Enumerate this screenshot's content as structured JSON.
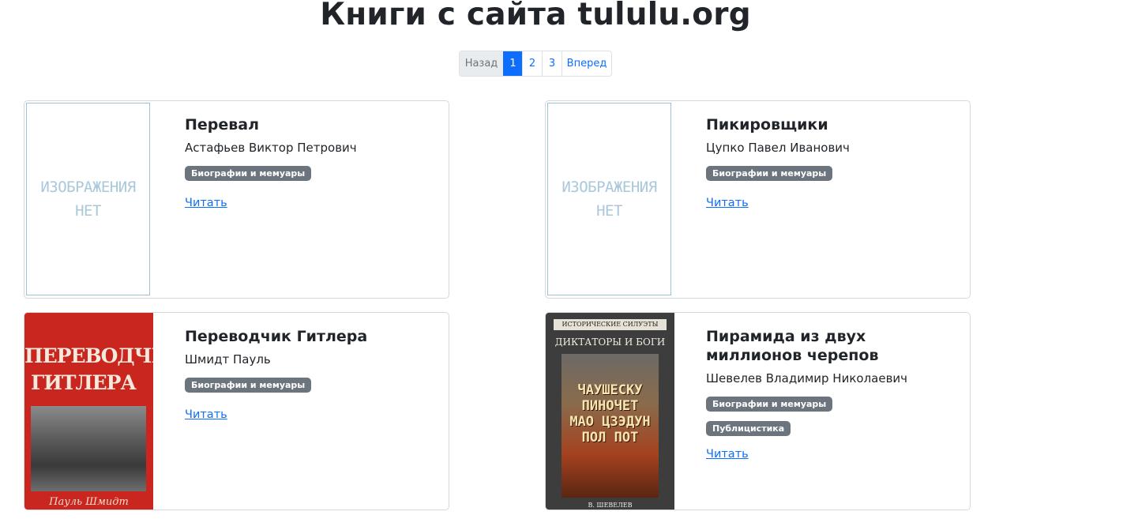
{
  "page": {
    "title": "Книги с сайта tululu.org"
  },
  "pagination": {
    "prev": "Назад",
    "pages": [
      "1",
      "2",
      "3"
    ],
    "current": "1",
    "next": "Вперед"
  },
  "no_image_text": [
    "ИЗОБРАЖЕНИЯ",
    "НЕТ"
  ],
  "books": [
    {
      "title": "Перевал",
      "author": "Астафьев Виктор Петрович",
      "genres": [
        "Биографии и мемуары"
      ],
      "read": "Читать",
      "cover": "no-image"
    },
    {
      "title": "Пикировщики",
      "author": "Цупко Павел Иванович",
      "genres": [
        "Биографии и мемуары"
      ],
      "read": "Читать",
      "cover": "no-image"
    },
    {
      "title": "Переводчик Гитлера",
      "author": "Шмидт Пауль",
      "genres": [
        "Биографии и мемуары"
      ],
      "read": "Читать",
      "cover": "red-cover",
      "cover_text": [
        "ПЕРЕВОДЧИК",
        "ГИТЛЕРА",
        "Пауль Шмидт"
      ]
    },
    {
      "title": "Пирамида из двух миллионов черепов",
      "author": "Шевелев Владимир Николаевич",
      "genres": [
        "Биографии и мемуары",
        "Публицистика"
      ],
      "read": "Читать",
      "cover": "dark-cover",
      "cover_text": [
        "ИСТОРИЧЕСКИЕ СИЛУЭТЫ",
        "ДИКТАТОРЫ И БОГИ",
        "ЧАУШЕСКУ",
        "ПИНОЧЕТ",
        "МАО ЦЗЭДУН",
        "ПОЛ ПОТ",
        "В. ШЕВЕЛЕВ"
      ]
    }
  ]
}
